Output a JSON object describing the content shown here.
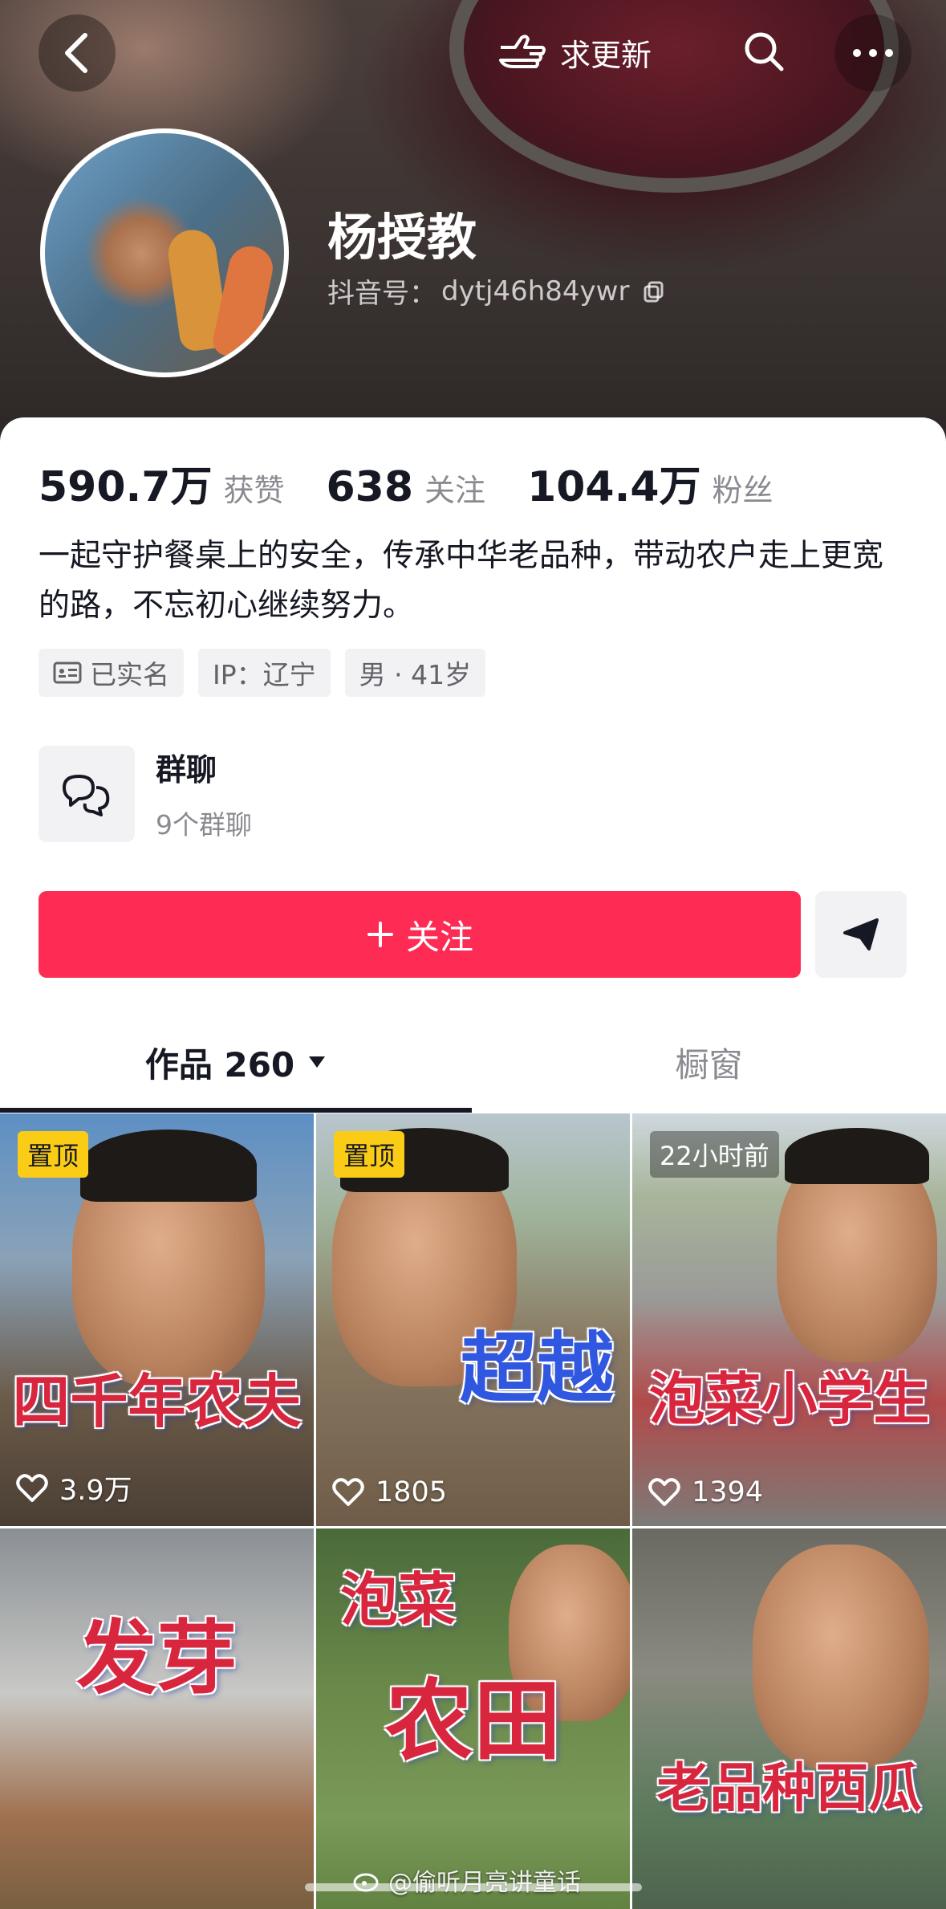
{
  "header": {
    "update_label": "求更新",
    "profile_name": "杨授教",
    "douyin_id_label": "抖音号：",
    "douyin_id": "dytj46h84ywr"
  },
  "stats": [
    {
      "num": "590.7万",
      "label": "获赞"
    },
    {
      "num": "638",
      "label": "关注"
    },
    {
      "num": "104.4万",
      "label": "粉丝"
    }
  ],
  "bio": "一起守护餐桌上的安全，传承中华老品种，带动农户走上更宽的路，不忘初心继续努力。",
  "tags": {
    "verified": "已实名",
    "ip": "IP：辽宁",
    "gender_age": "男 · 41岁"
  },
  "group_chat": {
    "title": "群聊",
    "subtitle": "9个群聊"
  },
  "actions": {
    "follow_label": "关注"
  },
  "tabs": {
    "works_label": "作品 260",
    "shop_label": "橱窗"
  },
  "videos": [
    {
      "badge": "置顶",
      "caption": "四千年农夫",
      "likes": "3.9万"
    },
    {
      "badge": "置顶",
      "caption": "超越",
      "likes": "1805"
    },
    {
      "badge": "22小时前",
      "caption": "泡菜小学生",
      "likes": "1394"
    },
    {
      "caption": "发芽"
    },
    {
      "caption_top": "泡菜",
      "caption": "农田"
    },
    {
      "caption": "老品种西瓜"
    }
  ],
  "watermark": "@偷听月亮讲童话",
  "colors": {
    "accent": "#fe2c55",
    "pin_badge": "#facc15",
    "caption_red": "#d8263f",
    "caption_blue": "#2f57e0"
  }
}
